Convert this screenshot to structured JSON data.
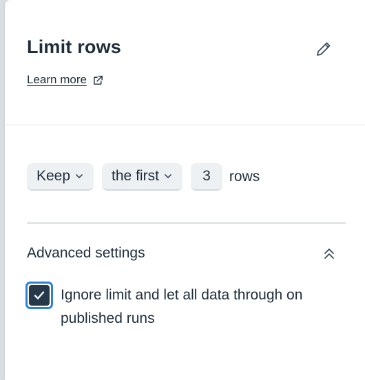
{
  "panel": {
    "title": "Limit rows",
    "learn_more": "Learn more"
  },
  "limit": {
    "mode_value": "Keep",
    "position_value": "the first",
    "count_value": "3",
    "unit_label": "rows"
  },
  "advanced": {
    "title": "Advanced settings",
    "ignore_limit_label": "Ignore limit and let all data through on published runs",
    "ignore_limit_checked": true
  },
  "colors": {
    "text": "#1f2d3a",
    "checkbox_fill": "#26384a",
    "focus_ring": "#2f7fd6",
    "chip_bg": "#eef1f4"
  },
  "icons": {
    "edit": "pencil-icon",
    "external": "external-link-icon",
    "dropdown": "chevron-down-icon",
    "collapse": "chevrons-up-icon",
    "check": "check-icon"
  }
}
